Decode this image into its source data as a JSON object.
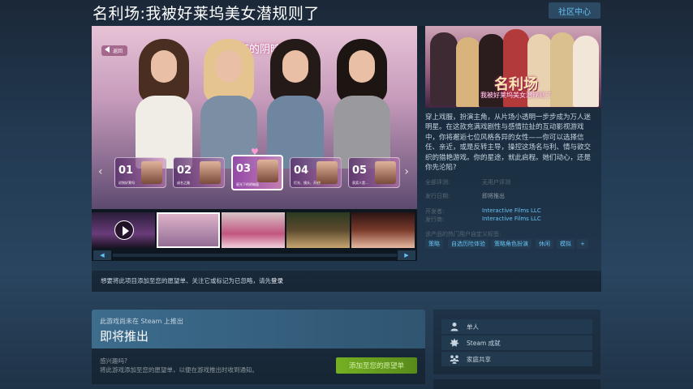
{
  "header": {
    "title": "名利场:我被好莱坞美女潜规则了",
    "community_button": "社区中心"
  },
  "screenshot": {
    "back_label": "返回",
    "heading": "星光下的阴暗面",
    "cards": [
      {
        "num": "01",
        "label": "初到好莱坞",
        "selected": false
      },
      {
        "num": "02",
        "label": "成名之路",
        "selected": false
      },
      {
        "num": "03",
        "label": "星光下的阴暗面",
        "selected": true
      },
      {
        "num": "04",
        "label": "灯光、镜头、开拍!",
        "selected": false
      },
      {
        "num": "05",
        "label": "获奖人是…",
        "selected": false
      }
    ]
  },
  "capsule": {
    "logo": "名利场",
    "subtitle": "我被好莱坞美女潜规则了"
  },
  "description": "穿上戏服，扮演主角，从片场小透明一步步成为万人迷明星。在这款充满戏剧性与感情拉扯的互动影视游戏中，你将邂逅七位风格各异的女性——你可以选择信任、亲近，或是反转主导，操控这场名与利、情与欲交织的猎艳游戏。你的星途，就此启程。她们动心，还是你先沦陷?",
  "info": {
    "reviews_key": "全部评测:",
    "reviews_val": "无用户评测",
    "release_key": "发行日期:",
    "release_val": "即将推出",
    "developer_key": "开发者:",
    "developer_val": "Interactive Films LLC",
    "publisher_key": "发行商:",
    "publisher_val": "Interactive Films LLC"
  },
  "tags_label": "该产品的热门用户自定义标签:",
  "tags": [
    "策略",
    "自选历险体验",
    "策略角色扮演",
    "休闲",
    "模拟",
    "+"
  ],
  "notice": {
    "text": "想要将此项目添加至您的愿望单、关注它或标记为已忽略，请先",
    "login": "登录"
  },
  "coming": {
    "sub": "此游戏尚未在 Steam 上推出",
    "main": "即将推出"
  },
  "wishlist": {
    "question": "感兴趣吗?",
    "desc": "将此游戏添加至您的愿望单，以便在游戏推出时收到通知。",
    "button": "添加至您的愿望单"
  },
  "features": [
    {
      "icon": "single-player-icon",
      "label": "单人"
    },
    {
      "icon": "achievements-icon",
      "label": "Steam 成就"
    },
    {
      "icon": "family-sharing-icon",
      "label": "家庭共享"
    }
  ],
  "colors": {
    "accent": "#67c1f5",
    "wishlist_green": "#75b022",
    "background": "#1b2838"
  }
}
